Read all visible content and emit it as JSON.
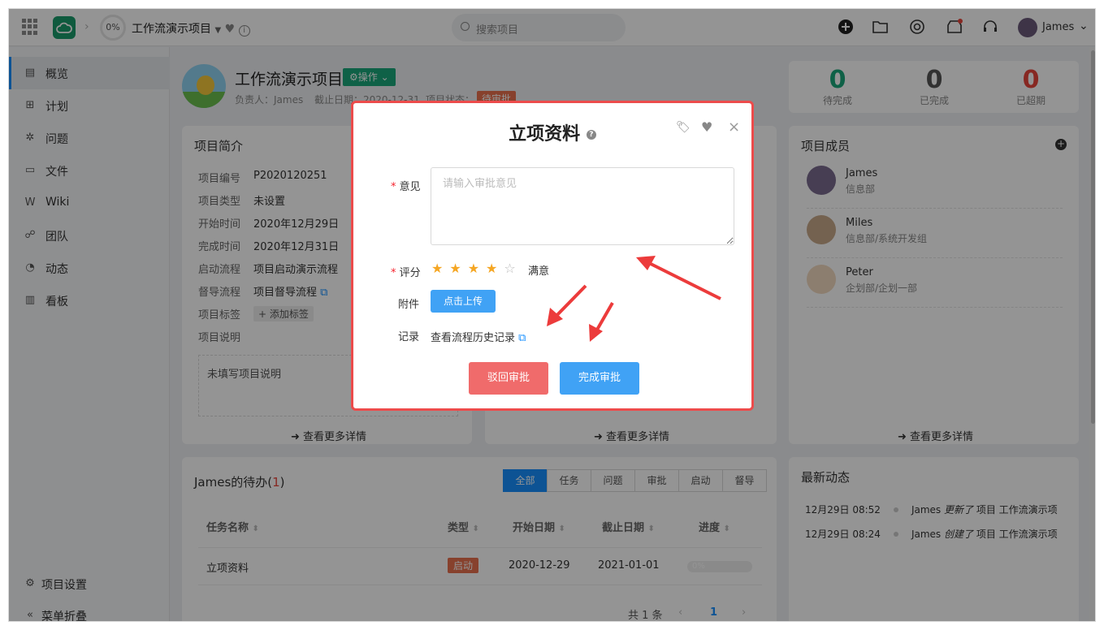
{
  "topbar": {
    "progress": "0%",
    "project_name": "工作流演示项目",
    "search_placeholder": "搜索项目",
    "user_name": "James"
  },
  "sidebar": {
    "items": [
      {
        "label": "概览",
        "icon": "overview-icon"
      },
      {
        "label": "计划",
        "icon": "plan-icon"
      },
      {
        "label": "问题",
        "icon": "bug-icon"
      },
      {
        "label": "文件",
        "icon": "folder-icon"
      },
      {
        "label": "Wiki",
        "icon": "wiki-icon"
      },
      {
        "label": "团队",
        "icon": "team-icon"
      },
      {
        "label": "动态",
        "icon": "activity-icon"
      },
      {
        "label": "看板",
        "icon": "board-icon"
      }
    ],
    "settings": "项目设置",
    "collapse": "菜单折叠"
  },
  "header": {
    "title": "工作流演示项目",
    "action": "操作",
    "owner": "负责人：James",
    "deadline": "截止日期：2020-12-31",
    "status_label": "项目状态：",
    "status": "待审批"
  },
  "stats": [
    {
      "value": "0",
      "label": "待完成",
      "color": "#1aa77a"
    },
    {
      "value": "0",
      "label": "已完成",
      "color": "#555555"
    },
    {
      "value": "0",
      "label": "已超期",
      "color": "#e8453c"
    }
  ],
  "intro": {
    "title": "项目简介",
    "fields": [
      {
        "k": "项目编号",
        "v": "P2020120251"
      },
      {
        "k": "项目类型",
        "v": "未设置"
      },
      {
        "k": "开始时间",
        "v": "2020年12月29日"
      },
      {
        "k": "完成时间",
        "v": "2020年12月31日"
      },
      {
        "k": "启动流程",
        "v": "项目启动演示流程"
      },
      {
        "k": "督导流程",
        "v": "项目督导流程"
      },
      {
        "k": "项目标签",
        "v": "+ 添加标签"
      },
      {
        "k": "项目说明",
        "v": ""
      }
    ],
    "desc": "未填写项目说明",
    "more": "查看更多详情"
  },
  "middle": {
    "more": "查看更多详情"
  },
  "members": {
    "title": "项目成员",
    "list": [
      {
        "name": "James",
        "dept": "信息部"
      },
      {
        "name": "Miles",
        "dept": "信息部/系统开发组"
      },
      {
        "name": "Peter",
        "dept": "企划部/企划一部"
      }
    ],
    "more": "查看更多详情"
  },
  "todo": {
    "title": "James的待办(",
    "count": "1",
    "close": ")",
    "tabs": [
      "全部",
      "任务",
      "问题",
      "审批",
      "启动",
      "督导"
    ],
    "columns": [
      "任务名称",
      "类型",
      "开始日期",
      "截止日期",
      "进度"
    ],
    "rows": [
      {
        "name": "立项资料",
        "type": "启动",
        "start": "2020-12-29",
        "end": "2021-01-01",
        "progress": "0%"
      }
    ],
    "total": "共 1 条",
    "page": "1"
  },
  "activity": {
    "title": "最新动态",
    "items": [
      {
        "time": "12月29日 08:52",
        "user": "James",
        "verb": "更新了",
        "obj": "项目 工作流演示项"
      },
      {
        "time": "12月29日 08:24",
        "user": "James",
        "verb": "创建了",
        "obj": "项目 工作流演示项"
      }
    ]
  },
  "modal": {
    "title": "立项资料",
    "opinion_label": "意见",
    "opinion_placeholder": "请输入审批意见",
    "rating_label": "评分",
    "rating": 4,
    "rating_max": 5,
    "rating_text": "满意",
    "attach_label": "附件",
    "upload": "点击上传",
    "record_label": "记录",
    "record_link": "查看流程历史记录",
    "reject": "驳回审批",
    "approve": "完成审批",
    "reject_color": "#f06b6b",
    "approve_color": "#40a2f5"
  },
  "colors": {
    "accent": "#1890ff",
    "annotation": "#ec4b4b"
  }
}
